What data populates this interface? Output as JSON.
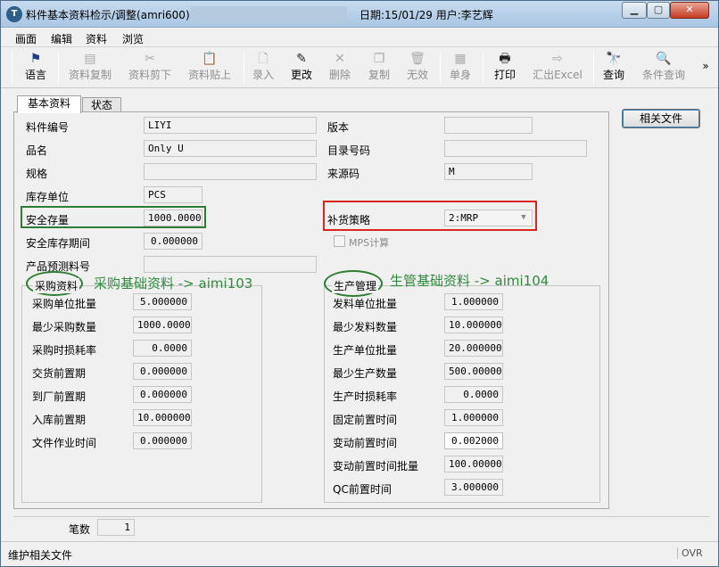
{
  "window": {
    "title": "料件基本资料检示/调整(amri600)",
    "date_user": "日期:15/01/29  用户:李艺辉",
    "app_icon": "T",
    "controls": {
      "minimize": "minimize-icon",
      "maximize": "maximize-icon",
      "close": "close-icon"
    }
  },
  "menu": [
    "画面",
    "编辑",
    "资料",
    "浏览"
  ],
  "toolbar": [
    {
      "label": "语言",
      "icon": "flag-icon",
      "glyph": "⚑",
      "state": "active"
    },
    {
      "label": "资料复制",
      "icon": "copy-data-icon",
      "glyph": "▤",
      "state": "disabled"
    },
    {
      "label": "资料剪下",
      "icon": "scissors-icon",
      "glyph": "✂",
      "state": "disabled"
    },
    {
      "label": "资料贴上",
      "icon": "paste-icon",
      "glyph": "📋",
      "state": "disabled"
    },
    {
      "label": "录入",
      "icon": "new-document-icon",
      "glyph": "🗋",
      "state": "disabled"
    },
    {
      "label": "更改",
      "icon": "pencil-icon",
      "glyph": "✎",
      "state": "active"
    },
    {
      "label": "删除",
      "icon": "delete-x-icon",
      "glyph": "✕",
      "state": "disabled"
    },
    {
      "label": "复制",
      "icon": "duplicate-icon",
      "glyph": "❐",
      "state": "disabled"
    },
    {
      "label": "无效",
      "icon": "trash-icon",
      "glyph": "🗑",
      "state": "disabled"
    },
    {
      "label": "单身",
      "icon": "detail-icon",
      "glyph": "▦",
      "state": "disabled"
    },
    {
      "label": "打印",
      "icon": "printer-icon",
      "glyph": "🖶",
      "state": "active"
    },
    {
      "label": "汇出Excel",
      "icon": "export-excel-icon",
      "glyph": "⇨",
      "state": "disabled"
    },
    {
      "label": "查询",
      "icon": "binoculars-icon",
      "glyph": "🔭",
      "state": "active"
    },
    {
      "label": "条件查询",
      "icon": "conditional-query-icon",
      "glyph": "🔍",
      "state": "disabled"
    }
  ],
  "toolbar_more": "»",
  "tabs": [
    "基本资料",
    "状态"
  ],
  "basic": {
    "item_no": {
      "label": "料件编号",
      "value": "LIYI"
    },
    "name": {
      "label": "品名",
      "value": "Only U"
    },
    "spec": {
      "label": "规格",
      "value": ""
    },
    "stock_unit": {
      "label": "库存单位",
      "value": "PCS"
    },
    "safety_stock": {
      "label": "安全存量",
      "value": "1000.00000"
    },
    "safety_period": {
      "label": "安全库存期间",
      "value": "0.000000"
    },
    "forecast_no": {
      "label": "产品预测料号",
      "value": ""
    },
    "version": {
      "label": "版本",
      "value": ""
    },
    "catalog_no": {
      "label": "目录号码",
      "value": ""
    },
    "source_code": {
      "label": "来源码",
      "value": "M"
    },
    "replenish": {
      "label": "补货策略",
      "value": "2:MRP"
    },
    "mps_calc": {
      "label": "MPS计算",
      "checked": false
    }
  },
  "purchase": {
    "title": "采购资料",
    "annotation": "采购基础资料 -> aimi103",
    "rows": [
      {
        "label": "采购单位批量",
        "value": "5.000000"
      },
      {
        "label": "最少采购数量",
        "value": "1000.0000"
      },
      {
        "label": "采购时损耗率",
        "value": "0.0000"
      },
      {
        "label": "交货前置期",
        "value": "0.000000"
      },
      {
        "label": "到厂前置期",
        "value": "0.000000"
      },
      {
        "label": "入库前置期",
        "value": "10.000000"
      },
      {
        "label": "文件作业时间",
        "value": "0.000000"
      }
    ]
  },
  "production": {
    "title": "生产管理",
    "annotation": "生管基础资料 -> aimi104",
    "rows": [
      {
        "label": "发料单位批量",
        "value": "1.000000"
      },
      {
        "label": "最少发料数量",
        "value": "10.000000"
      },
      {
        "label": "生产单位批量",
        "value": "20.000000"
      },
      {
        "label": "最少生产数量",
        "value": "500.000000"
      },
      {
        "label": "生产时损耗率",
        "value": "0.0000"
      },
      {
        "label": "固定前置时间",
        "value": "1.000000"
      },
      {
        "label": "变动前置时间",
        "value": "0.002000"
      },
      {
        "label": "变动前置时间批量",
        "value": "100.000000"
      },
      {
        "label": "QC前置时间",
        "value": "3.000000"
      }
    ]
  },
  "related_button": "相关文件",
  "record_count": {
    "label": "笔数",
    "value": "1"
  },
  "statusbar": {
    "text": "维护相关文件",
    "mode": "OVR"
  },
  "colors": {
    "annotation_green": "#2e7d32",
    "highlight_red": "#d9251d",
    "title_gradient": "#a9c6e3"
  }
}
